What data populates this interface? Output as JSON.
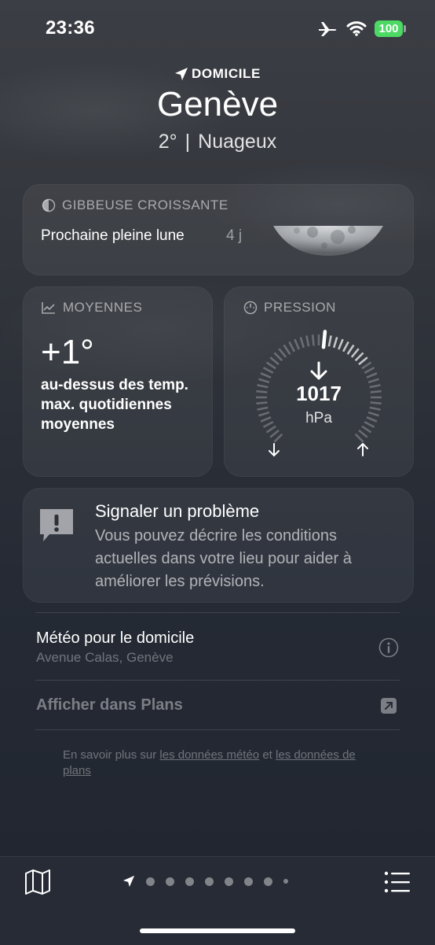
{
  "status_bar": {
    "time": "23:36",
    "battery": "100"
  },
  "header": {
    "location_label": "DOMICILE",
    "city": "Genève",
    "temperature": "2°",
    "condition": "Nuageux"
  },
  "moon": {
    "title": "GIBBEUSE CROISSANTE",
    "next_label": "Prochaine pleine lune",
    "days": "4 j"
  },
  "averages": {
    "title": "MOYENNES",
    "value": "+1°",
    "description": "au-dessus des temp. max. quotidiennes moyennes"
  },
  "pressure": {
    "title": "PRESSION",
    "value": "1017",
    "unit": "hPa",
    "trend": "falling"
  },
  "report": {
    "title": "Signaler un problème",
    "text": "Vous pouvez décrire les conditions actuelles dans votre lieu pour aider à améliorer les prévisions."
  },
  "home_weather": {
    "title": "Météo pour le domicile",
    "address": "Avenue Calas, Genève"
  },
  "maps_link": "Afficher dans Plans",
  "footer": {
    "prefix": "En savoir plus sur ",
    "link1": "les données météo",
    "middle": " et ",
    "link2": "les données de plans"
  },
  "tab_bar": {
    "page_count": 9,
    "icons": [
      "map-icon",
      "location-arrow-icon",
      "list-icon"
    ]
  },
  "colors": {
    "battery": "#4cd964",
    "background": "#2c3038"
  }
}
